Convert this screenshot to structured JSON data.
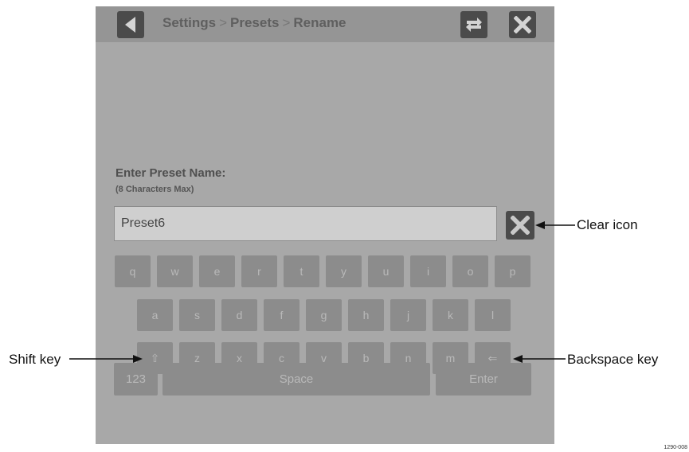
{
  "header": {
    "breadcrumb": [
      "Settings",
      "Presets",
      "Rename"
    ],
    "separator": ">",
    "back_icon": "back-arrow-icon",
    "swap_icon": "swap-icon",
    "close_icon": "close-icon"
  },
  "prompt": {
    "title": "Enter Preset Name:",
    "subtitle": "(8 Characters Max)"
  },
  "name_input": {
    "value": "Preset6"
  },
  "clear_icon": "clear-icon",
  "keyboard": {
    "row1": [
      "q",
      "w",
      "e",
      "r",
      "t",
      "y",
      "u",
      "i",
      "o",
      "p"
    ],
    "row2": [
      "a",
      "s",
      "d",
      "f",
      "g",
      "h",
      "j",
      "k",
      "l"
    ],
    "row3": [
      "⇧",
      "z",
      "x",
      "c",
      "v",
      "b",
      "n",
      "m",
      "⇐"
    ],
    "row4": {
      "numbers": "123",
      "space": "Space",
      "enter": "Enter"
    }
  },
  "callouts": {
    "clear": "Clear icon",
    "shift": "Shift key",
    "backspace": "Backspace key"
  },
  "figure_id": "1290-008",
  "colors": {
    "panel": "#a8a8a8",
    "topbar": "#959595",
    "key": "#8c8c8c",
    "icon": "#4b4b4b"
  }
}
